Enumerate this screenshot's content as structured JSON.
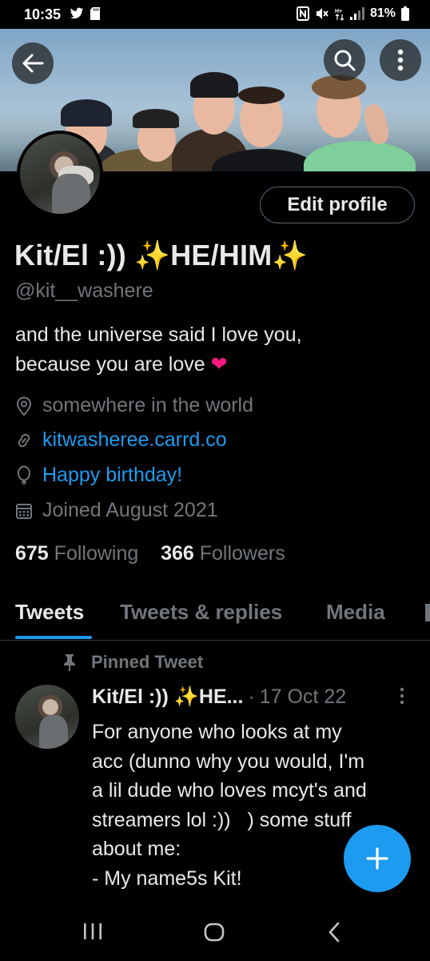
{
  "status_bar": {
    "time": "10:35",
    "battery": "81%",
    "icons": [
      "twitter-icon",
      "sd-card-icon",
      "nfc-icon",
      "mute-icon",
      "data-icon",
      "signal-icon",
      "battery-icon"
    ]
  },
  "header": {
    "icons": [
      "back-arrow-icon",
      "search-icon",
      "more-vertical-icon"
    ]
  },
  "profile": {
    "edit_label": "Edit profile",
    "display_name": "Kit/El :)) ✨HE/HIM✨",
    "handle": "@kit__washere",
    "bio_line1": "and the universe said I love you,",
    "bio_line2": "because you are love ",
    "bio_emoji": "❤",
    "location": "somewhere in the world",
    "link": "kitwasheree.carrd.co",
    "birthday": "Happy birthday!",
    "joined": "Joined August 2021",
    "following_count": "675",
    "following_label": "Following",
    "followers_count": "366",
    "followers_label": "Followers"
  },
  "tabs": [
    {
      "label": "Tweets",
      "active": true
    },
    {
      "label": "Tweets & replies",
      "active": false
    },
    {
      "label": "Media",
      "active": false
    }
  ],
  "tweet": {
    "pinned_label": "Pinned Tweet",
    "name": "Kit/El :)) ✨HE...",
    "separator": "·",
    "date": "17 Oct 22",
    "text": "For anyone who looks at my\nacc (dunno why you would, I'm\na lil dude who loves mcyt's and\nstreamers lol :))   ) some stuff\nabout me:\n- My name5s Kit!"
  },
  "colors": {
    "accent": "#1d9bf0",
    "secondary_text": "#71767b",
    "primary_text": "#e7e9ea",
    "heart": "#f91880",
    "background": "#000000"
  }
}
